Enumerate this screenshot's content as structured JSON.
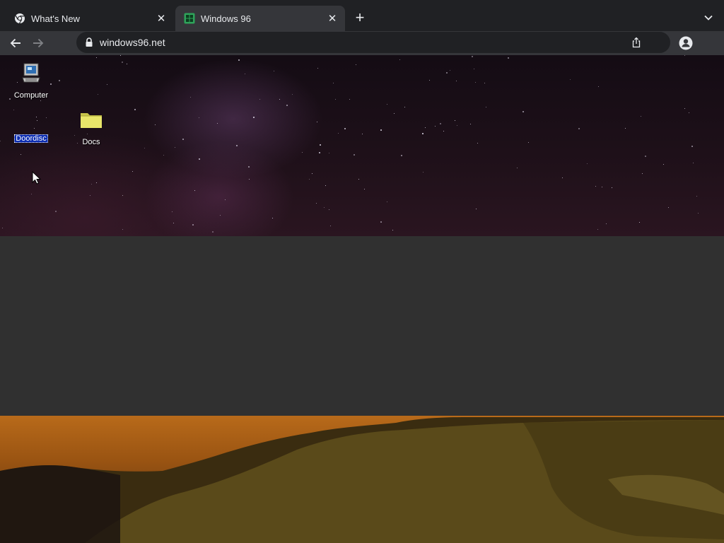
{
  "browser": {
    "tabs": [
      {
        "title": "What's New",
        "favicon": "chrome-icon",
        "active": false
      },
      {
        "title": "Windows 96",
        "favicon": "windows96-icon",
        "active": true
      }
    ],
    "new_tab_icon": "plus-icon",
    "tab_search_icon": "chevron-down-icon",
    "back_icon": "arrow-left-icon",
    "forward_icon": "arrow-right-icon",
    "address": {
      "security_icon": "lock-icon",
      "url": "windows96.net",
      "share_icon": "share-icon"
    },
    "profile_icon": "person-icon"
  },
  "desktop": {
    "icons": [
      {
        "label": "Computer",
        "icon": "computer-icon",
        "selected": false
      },
      {
        "label": "Doordisc",
        "icon": "blank-icon",
        "selected": true
      },
      {
        "label": "Docs",
        "icon": "folder-icon",
        "selected": false
      }
    ]
  },
  "colors": {
    "tabstrip": "#202124",
    "toolbar": "#35363a",
    "text": "#e8eaed",
    "selection": "#0a2bb0",
    "folder": "#e8e56a",
    "gap": "#303030"
  }
}
